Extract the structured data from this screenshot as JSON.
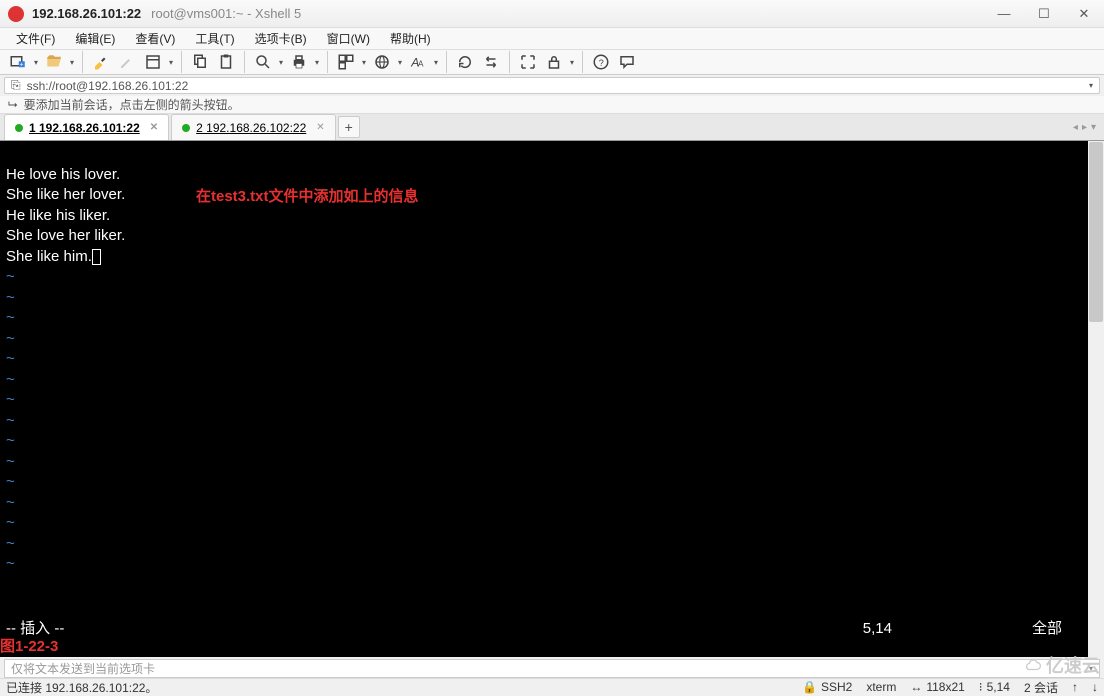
{
  "title": {
    "ip": "192.168.26.101:22",
    "rest": "root@vms001:~ - Xshell 5"
  },
  "menu": [
    "文件(F)",
    "编辑(E)",
    "查看(V)",
    "工具(T)",
    "选项卡(B)",
    "窗口(W)",
    "帮助(H)"
  ],
  "address": {
    "url": "ssh://root@192.168.26.101:22"
  },
  "hint": "要添加当前会话，点击左侧的箭头按钮。",
  "tabs": [
    {
      "label": "1 192.168.26.101:22",
      "active": true
    },
    {
      "label": "2 192.168.26.102:22",
      "active": false
    }
  ],
  "terminal": {
    "lines": [
      "He love his lover.",
      "She like her lover.",
      "He like his liker.",
      "She love her liker.",
      "She like him."
    ],
    "mode": "-- 插入 --",
    "cursor_pos": "5,14",
    "scroll_indicator": "全部",
    "annotation_text": "在test3.txt文件中添加如上的信息",
    "figure_label": "图1-22-3"
  },
  "input_placeholder": "仅将文本发送到当前选项卡",
  "status": {
    "connection": "已连接 192.168.26.101:22。",
    "protocol": "SSH2",
    "term_type": "xterm",
    "size": "118x21",
    "pos": "5,14",
    "sessions": "2 会话"
  },
  "watermark": "亿速云"
}
